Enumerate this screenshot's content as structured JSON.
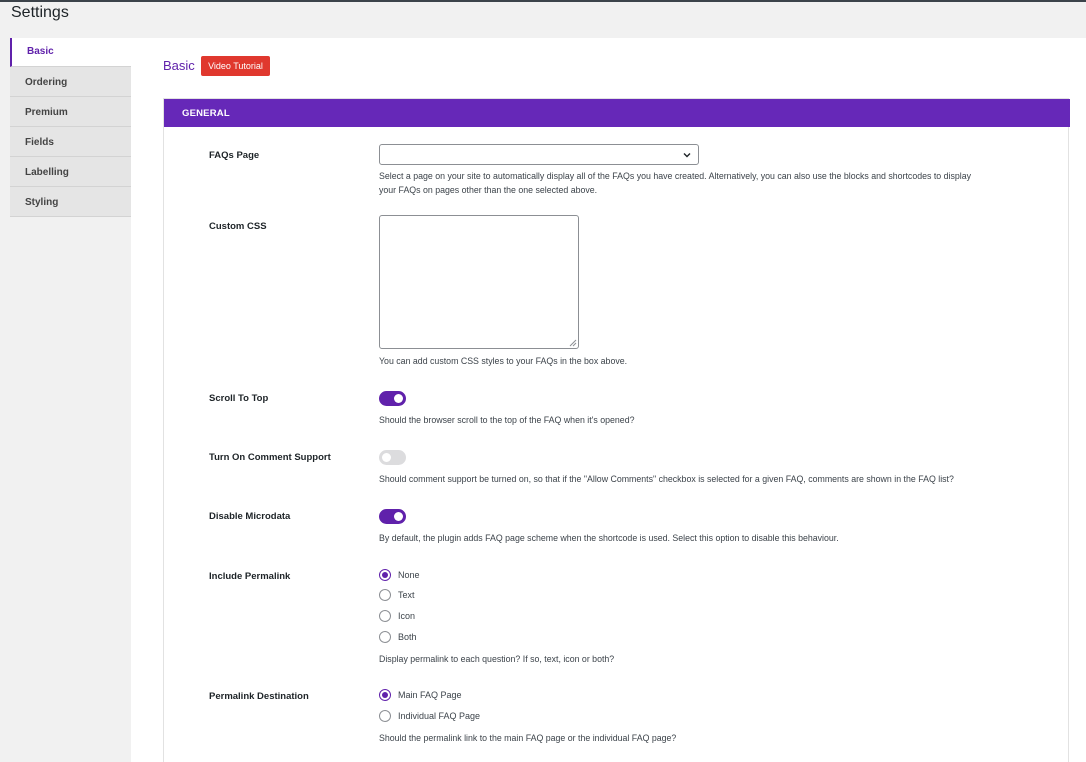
{
  "page": {
    "title": "Settings"
  },
  "sidebar": {
    "items": [
      {
        "label": "Basic",
        "active": true
      },
      {
        "label": "Ordering"
      },
      {
        "label": "Premium"
      },
      {
        "label": "Fields"
      },
      {
        "label": "Labelling"
      },
      {
        "label": "Styling"
      }
    ]
  },
  "main": {
    "heading": "Basic",
    "tutorial_button": "Video Tutorial",
    "panel_title": "GENERAL"
  },
  "fields": {
    "faqs_page": {
      "label": "FAQs Page",
      "value": "",
      "desc1": "Select a page on your site to automatically display all of the FAQs you have created. Alternatively, you can also use the blocks and shortcodes to display",
      "desc2": "your FAQs on pages other than the one selected above."
    },
    "custom_css": {
      "label": "Custom CSS",
      "value": "",
      "desc": "You can add custom CSS styles to your FAQs in the box above."
    },
    "scroll_to_top": {
      "label": "Scroll To Top",
      "on": true,
      "desc": "Should the browser scroll to the top of the FAQ when it's opened?"
    },
    "comment_support": {
      "label": "Turn On Comment Support",
      "on": false,
      "desc": "Should comment support be turned on, so that if the \"Allow Comments\" checkbox is selected for a given FAQ, comments are shown in the FAQ list?"
    },
    "disable_microdata": {
      "label": "Disable Microdata",
      "on": true,
      "desc": "By default, the plugin adds FAQ page scheme when the shortcode is used. Select this option to disable this behaviour."
    },
    "include_permalink": {
      "label": "Include Permalink",
      "options": [
        "None",
        "Text",
        "Icon",
        "Both"
      ],
      "selected": "None",
      "desc": "Display permalink to each question? If so, text, icon or both?"
    },
    "permalink_destination": {
      "label": "Permalink Destination",
      "options": [
        "Main FAQ Page",
        "Individual FAQ Page"
      ],
      "selected": "Main FAQ Page",
      "desc": "Should the permalink link to the main FAQ page or the individual FAQ page?"
    }
  },
  "colors": {
    "accent": "#6021ab",
    "tutorial": "#e0382e",
    "header": "#6628b8"
  },
  "icons": {
    "select": "chevron-down-icon",
    "textarea": "resize-handle-icon"
  }
}
